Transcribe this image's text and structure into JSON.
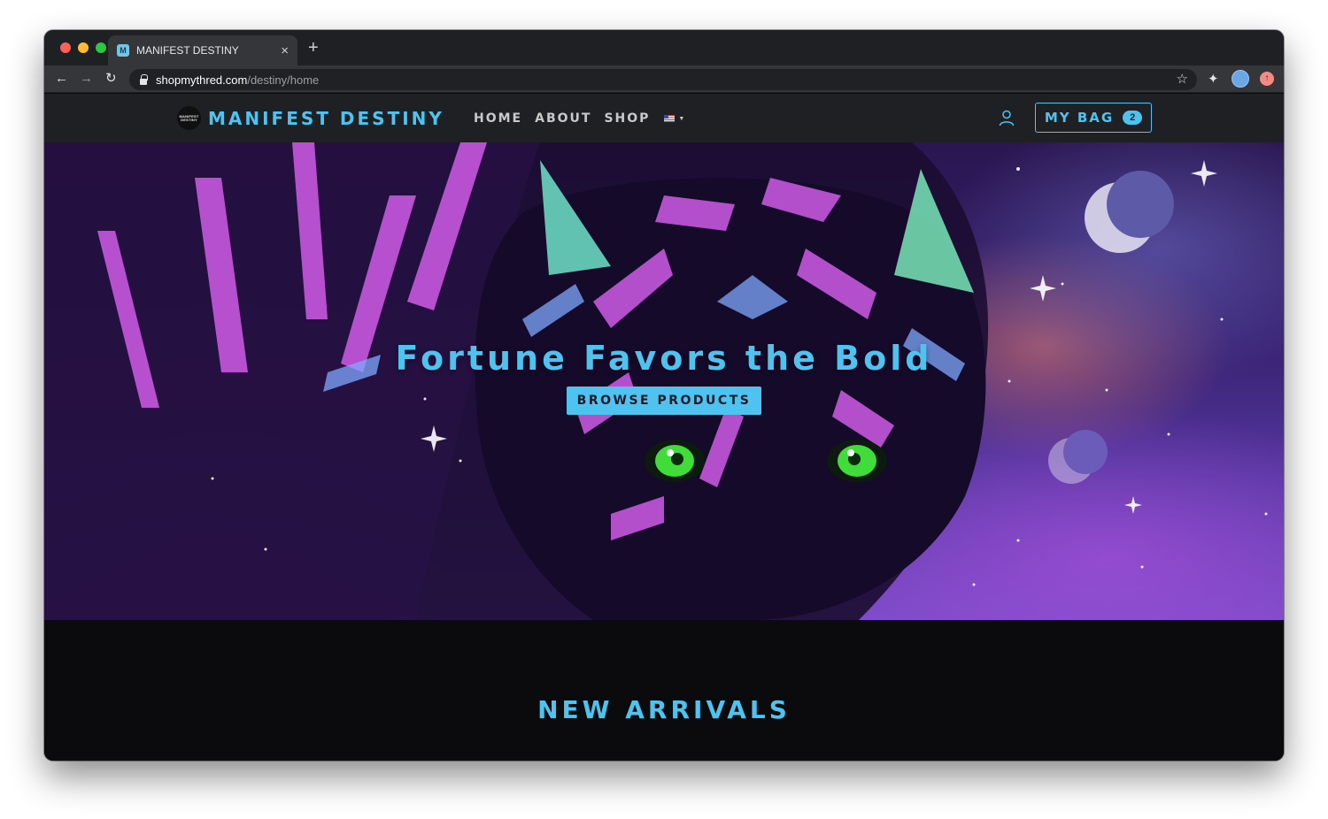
{
  "browser": {
    "tab_title": "MANIFEST DESTINY",
    "favicon_text": "M",
    "tab_close_glyph": "×",
    "new_tab_glyph": "+",
    "url_host": "shopmythred.com",
    "url_path": "/destiny/home",
    "icons": {
      "back": "←",
      "forward": "→",
      "reload": "↻",
      "bookmark": "☆",
      "extensions": "✦",
      "update": "↑"
    }
  },
  "site": {
    "brand_name": "MANIFEST DESTINY",
    "brand_logo_text": "MANIFEST DESTINY",
    "nav": [
      {
        "label": "HOME"
      },
      {
        "label": "ABOUT"
      },
      {
        "label": "SHOP"
      }
    ],
    "currency_caret": "▼",
    "bag_label": "MY BAG",
    "bag_count": "2",
    "accent_color": "#4fc3f0"
  },
  "hero": {
    "title": "Fortune Favors the Bold",
    "button_label": "BROWSE PRODUCTS"
  },
  "arrivals": {
    "title": "NEW ARRIVALS"
  }
}
